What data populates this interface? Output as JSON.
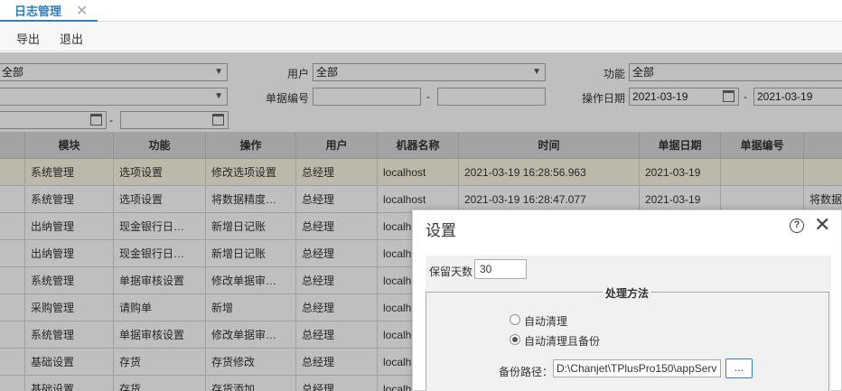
{
  "tab": {
    "label": "日志管理",
    "close": "✕"
  },
  "toolbar": {
    "export": "导出",
    "exit": "退出"
  },
  "filters": {
    "f1_value": "全部",
    "user_label": "用户",
    "user_value": "全部",
    "function_label": "功能",
    "function_value": "全部",
    "f2_value": "",
    "doc_no_label": "单据编号",
    "doc_no_from": "",
    "doc_no_to": "",
    "dash": "-",
    "op_date_label": "操作日期",
    "op_date_from": "2021-03-19",
    "op_date_to": "2021-03-19",
    "f3_from": "",
    "f3_to": ""
  },
  "table": {
    "columns": [
      "",
      "模块",
      "功能",
      "操作",
      "用户",
      "机器名称",
      "时间",
      "单据日期",
      "单据编号",
      ""
    ],
    "rows": [
      [
        "",
        "系统管理",
        "选项设置",
        "修改选项设置",
        "总经理",
        "localhost",
        "2021-03-19 16:28:56.963",
        "2021-03-19",
        "",
        ""
      ],
      [
        "",
        "系统管理",
        "选项设置",
        "将数据精度…",
        "总经理",
        "localhost",
        "2021-03-19 16:28:47.077",
        "2021-03-19",
        "",
        "将数据"
      ],
      [
        "",
        "出纳管理",
        "现金银行日…",
        "新增日记账",
        "总经理",
        "localh",
        "",
        "",
        "",
        ""
      ],
      [
        "",
        "出纳管理",
        "现金银行日…",
        "新增日记账",
        "总经理",
        "localh",
        "",
        "",
        "",
        ""
      ],
      [
        "",
        "系统管理",
        "单据审核设置",
        "修改单据审…",
        "总经理",
        "localh",
        "",
        "",
        "",
        ""
      ],
      [
        "",
        "采购管理",
        "请购单",
        "新增",
        "总经理",
        "localh",
        "",
        "",
        "",
        ""
      ],
      [
        "",
        "系统管理",
        "单据审核设置",
        "修改单据审…",
        "总经理",
        "localh",
        "",
        "",
        "",
        ""
      ],
      [
        "",
        "基础设置",
        "存货",
        "存货修改",
        "总经理",
        "localh",
        "",
        "",
        "",
        ""
      ],
      [
        "",
        "基础设置",
        "存货",
        "存货添加",
        "总经理",
        "localh",
        "",
        "",
        "",
        ""
      ]
    ]
  },
  "dialog": {
    "title": "设置",
    "help": "?",
    "close": "✕",
    "retain_days_label": "保留天数",
    "retain_days_value": "30",
    "method_legend": "处理方法",
    "option_auto_clean": "自动清理",
    "option_auto_clean_backup": "自动清理且备份",
    "selected_option": "自动清理且备份",
    "backup_path_label": "备份路径：",
    "backup_path_value": "D:\\Chanjet\\TPlusPro150\\appServ",
    "browse_label": "..."
  }
}
